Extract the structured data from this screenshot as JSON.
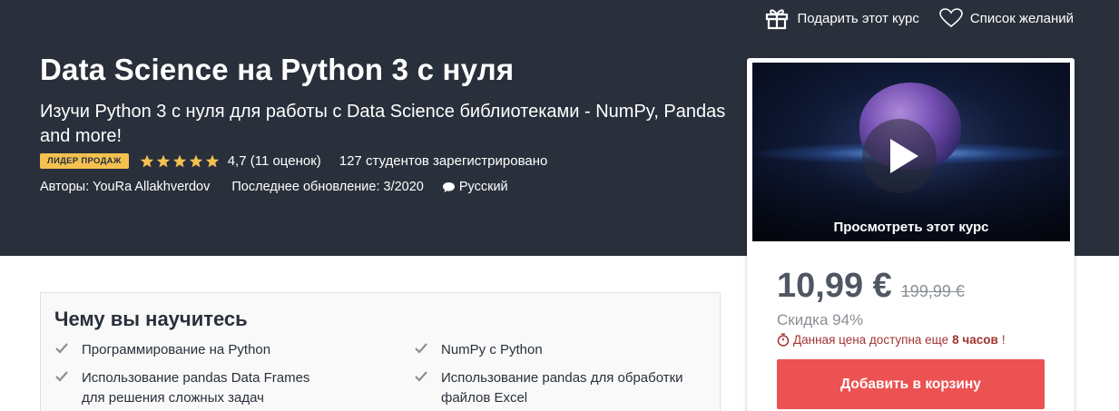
{
  "top_actions": {
    "gift_label": "Подарить этот курс",
    "wishlist_label": "Список желаний"
  },
  "course": {
    "title": "Data Science на Python 3 с нуля",
    "subtitle": "Изучи Python 3 с нуля для работы с Data Science библиотеками - NumPy, Pandas and more!",
    "badge": "ЛИДЕР ПРОДАЖ",
    "rating_value": 4.7,
    "rating_text": "4,7 (11 оценок)",
    "students_text": "127 студентов зарегистрировано",
    "authors_label": "Авторы:",
    "author_name": "YouRa Allakhverdov",
    "last_update": "Последнее обновление: 3/2020",
    "language": "Русский"
  },
  "sidebar": {
    "preview_label": "Просмотреть этот курс",
    "price": "10,99 €",
    "original_price": "199,99 €",
    "discount": "Скидка 94%",
    "urgency_prefix": "Данная цена доступна еще",
    "urgency_time": "8 часов",
    "urgency_suffix": "!",
    "add_to_cart": "Добавить в корзину"
  },
  "learn": {
    "title": "Чему вы научитесь",
    "items": [
      "Программирование на Python",
      "NumPy с Python",
      "Использование pandas Data Frames для решения сложных задач",
      "Использование pandas для обработки файлов Excel"
    ]
  },
  "colors": {
    "hero_bg": "#29303b",
    "badge_bg": "#f4c150",
    "star": "#f4c150",
    "cart_button": "#ec5252",
    "urgency": "#a13332"
  },
  "icons": [
    "gift-icon",
    "heart-icon",
    "star-icon",
    "speech-bubble-icon",
    "play-icon",
    "stopwatch-icon",
    "check-icon"
  ]
}
